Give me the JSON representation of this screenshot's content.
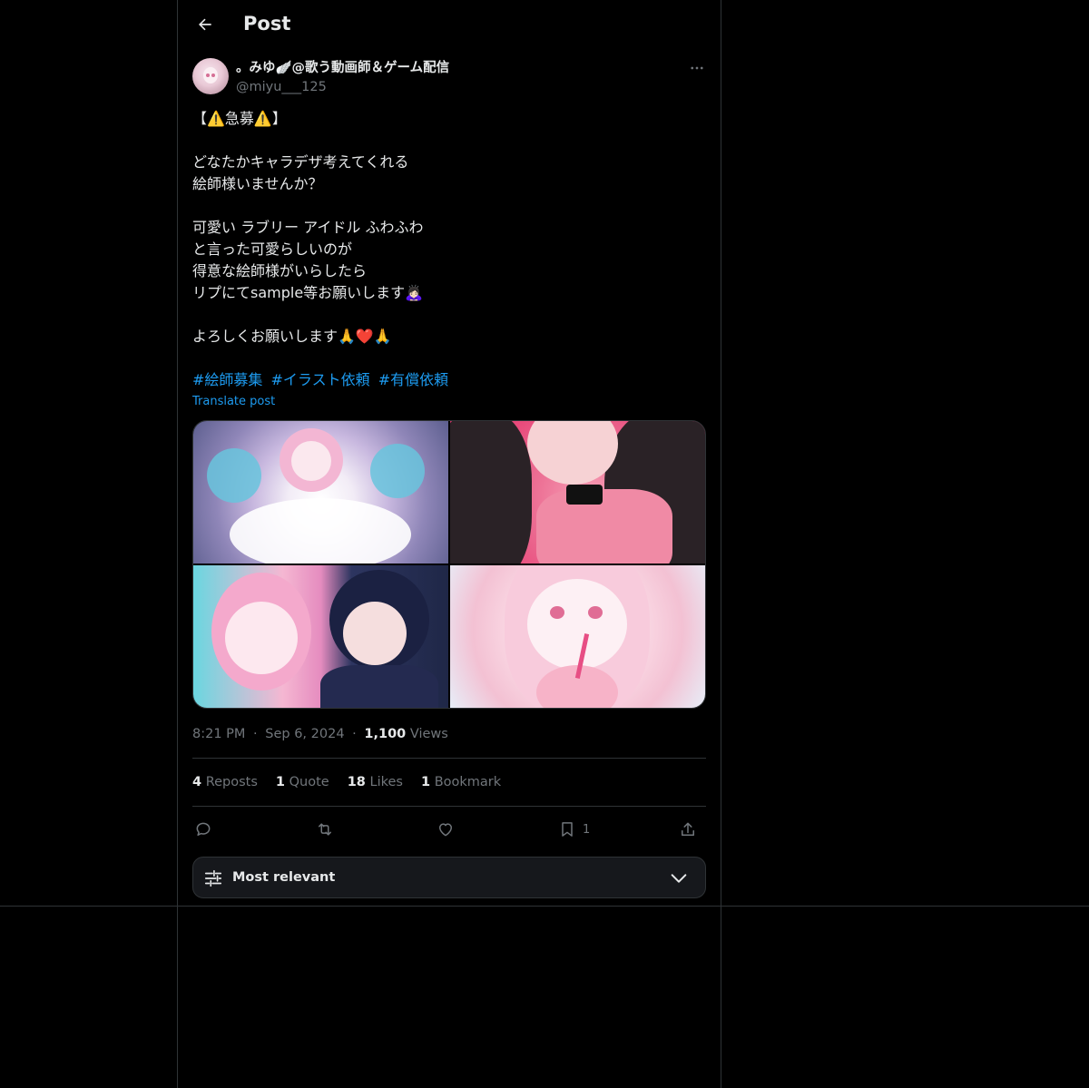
{
  "header": {
    "title": "Post"
  },
  "author": {
    "display_name": "。みゆ🪽@歌う動画師＆ゲーム配信",
    "handle": "@miyu___125"
  },
  "post": {
    "text": "【⚠️急募⚠️】\n\nどなたかキャラデザ考えてくれる\n絵師様いませんか？\n\n可愛い ラブリー アイドル ふわふわ\nと言った可愛らしいのが\n得意な絵師様がいらしたら\nリプにてsample等お願いします🙇🏻‍♀️\n\nよろしくお願いします🙏❤️🙏",
    "hashtags": [
      "#絵師募集",
      "#イラスト依頼",
      "#有償依頼"
    ],
    "translate_label": "Translate post"
  },
  "meta": {
    "time": "8:21 PM",
    "separator": "·",
    "date": "Sep 6, 2024",
    "views_count": "1,100",
    "views_label": "Views"
  },
  "stats": {
    "reposts_count": "4",
    "reposts_label": "Reposts",
    "quotes_count": "1",
    "quotes_label": "Quote",
    "likes_count": "18",
    "likes_label": "Likes",
    "bookmarks_count": "1",
    "bookmarks_label": "Bookmark"
  },
  "actions": {
    "bookmark_count": "1",
    "icons": [
      "reply-icon",
      "repost-icon",
      "like-icon",
      "bookmark-icon",
      "share-icon"
    ]
  },
  "sort": {
    "label": "Most relevant"
  },
  "colors": {
    "accent": "#1d9bf0",
    "background": "#000000",
    "muted": "#71767b",
    "text": "#e7e9ea"
  }
}
